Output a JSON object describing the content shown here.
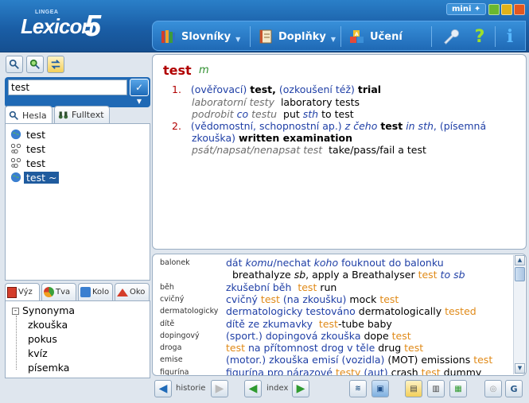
{
  "brand": {
    "lingea": "LINGEA",
    "name": "Lexicon",
    "version": "5"
  },
  "window": {
    "mini_label": "mini"
  },
  "menu": {
    "items": [
      {
        "label": "Slovníky"
      },
      {
        "label": "Doplňky"
      },
      {
        "label": "Učení"
      }
    ]
  },
  "search": {
    "value": "test"
  },
  "tabs_top": [
    {
      "label": "Hesla"
    },
    {
      "label": "Fulltext"
    }
  ],
  "list": [
    {
      "text": "test"
    },
    {
      "text": "test"
    },
    {
      "text": "test"
    },
    {
      "text": "test ~"
    }
  ],
  "tabs_bottom": [
    {
      "label": "Výz"
    },
    {
      "label": "Tva"
    },
    {
      "label": "Kolo"
    },
    {
      "label": "Oko"
    }
  ],
  "tree": {
    "root": "Synonyma",
    "children": [
      "zkouška",
      "pokus",
      "kvíz",
      "písemka"
    ]
  },
  "entry": {
    "headword": "test",
    "pos": "m",
    "senses": [
      {
        "num": "1.",
        "line1": {
          "p1": "(ověřovací)",
          "p2": "test,",
          "p3": "(ozkoušení též)",
          "p4": "trial"
        },
        "ex1": {
          "cz": "laboratorní testy",
          "en": "laboratory tests"
        },
        "ex2": {
          "cz1": "podrobit",
          "cz2": "co",
          "cz3": "testu",
          "en1": "put",
          "en2": "sth",
          "en3": "to test"
        }
      },
      {
        "num": "2.",
        "line1": {
          "p1": "(vědomostní, schopnostní ap.)",
          "p2": "z čeho",
          "p3": "test",
          "p4": "in sth",
          "p5": ", (písemná"
        },
        "line2": {
          "p1": "zkouška)",
          "p2": "written examination"
        },
        "ex1": {
          "cz": "psát/napsat/nenapsat test",
          "en": "take/pass/fail a test"
        }
      }
    ]
  },
  "index_rows": [
    {
      "key": "balonek",
      "segs": [
        [
          "blue",
          "dát "
        ],
        [
          "blue it",
          "komu"
        ],
        [
          "blue",
          "/nechat "
        ],
        [
          "blue it",
          "koho"
        ],
        [
          "blue",
          " fouknout do balonku"
        ]
      ]
    },
    {
      "key": "",
      "segs": [
        [
          "",
          "  breathalyze "
        ],
        [
          "it",
          "sb"
        ],
        [
          "",
          ", apply a Breathalyser "
        ],
        [
          "orange",
          "test "
        ],
        [
          "blue it",
          "to sb"
        ]
      ]
    },
    {
      "key": "běh",
      "segs": [
        [
          "blue",
          "zkušební běh  "
        ],
        [
          "orange",
          "test"
        ],
        [
          "",
          " run"
        ]
      ]
    },
    {
      "key": "cvičný",
      "segs": [
        [
          "blue",
          "cvičný "
        ],
        [
          "orange",
          "test"
        ],
        [
          "blue",
          " (na zkoušku)"
        ],
        [
          "",
          " mock "
        ],
        [
          "orange",
          "test"
        ]
      ]
    },
    {
      "key": "dermatologicky",
      "segs": [
        [
          "blue",
          "dermatologicky testováno"
        ],
        [
          "",
          " dermatologically "
        ],
        [
          "orange",
          "tested"
        ]
      ]
    },
    {
      "key": "dítě",
      "segs": [
        [
          "blue",
          "dítě ze zkumavky  "
        ],
        [
          "orange",
          "test"
        ],
        [
          "",
          "-tube baby"
        ]
      ]
    },
    {
      "key": "dopingový",
      "segs": [
        [
          "blue",
          "(sport.) dopingová zkouška"
        ],
        [
          "",
          " dope "
        ],
        [
          "orange",
          "test"
        ]
      ]
    },
    {
      "key": "droga",
      "segs": [
        [
          "orange",
          "test"
        ],
        [
          "blue",
          " na přítomnost drog v těle"
        ],
        [
          "",
          " drug "
        ],
        [
          "orange",
          "test"
        ]
      ]
    },
    {
      "key": "emise",
      "segs": [
        [
          "blue",
          "(motor.) zkouška emisí (vozidla)"
        ],
        [
          "",
          " (MOT) emissions "
        ],
        [
          "orange",
          "test"
        ]
      ]
    },
    {
      "key": "figurína",
      "segs": [
        [
          "blue",
          "figurína pro nárazové "
        ],
        [
          "orange",
          "testy"
        ],
        [
          "blue",
          " (aut)"
        ],
        [
          "",
          " crash "
        ],
        [
          "orange",
          "test"
        ],
        [
          "",
          " dummy"
        ]
      ]
    }
  ],
  "bottom": {
    "history_label": "historie",
    "index_label": "index"
  }
}
